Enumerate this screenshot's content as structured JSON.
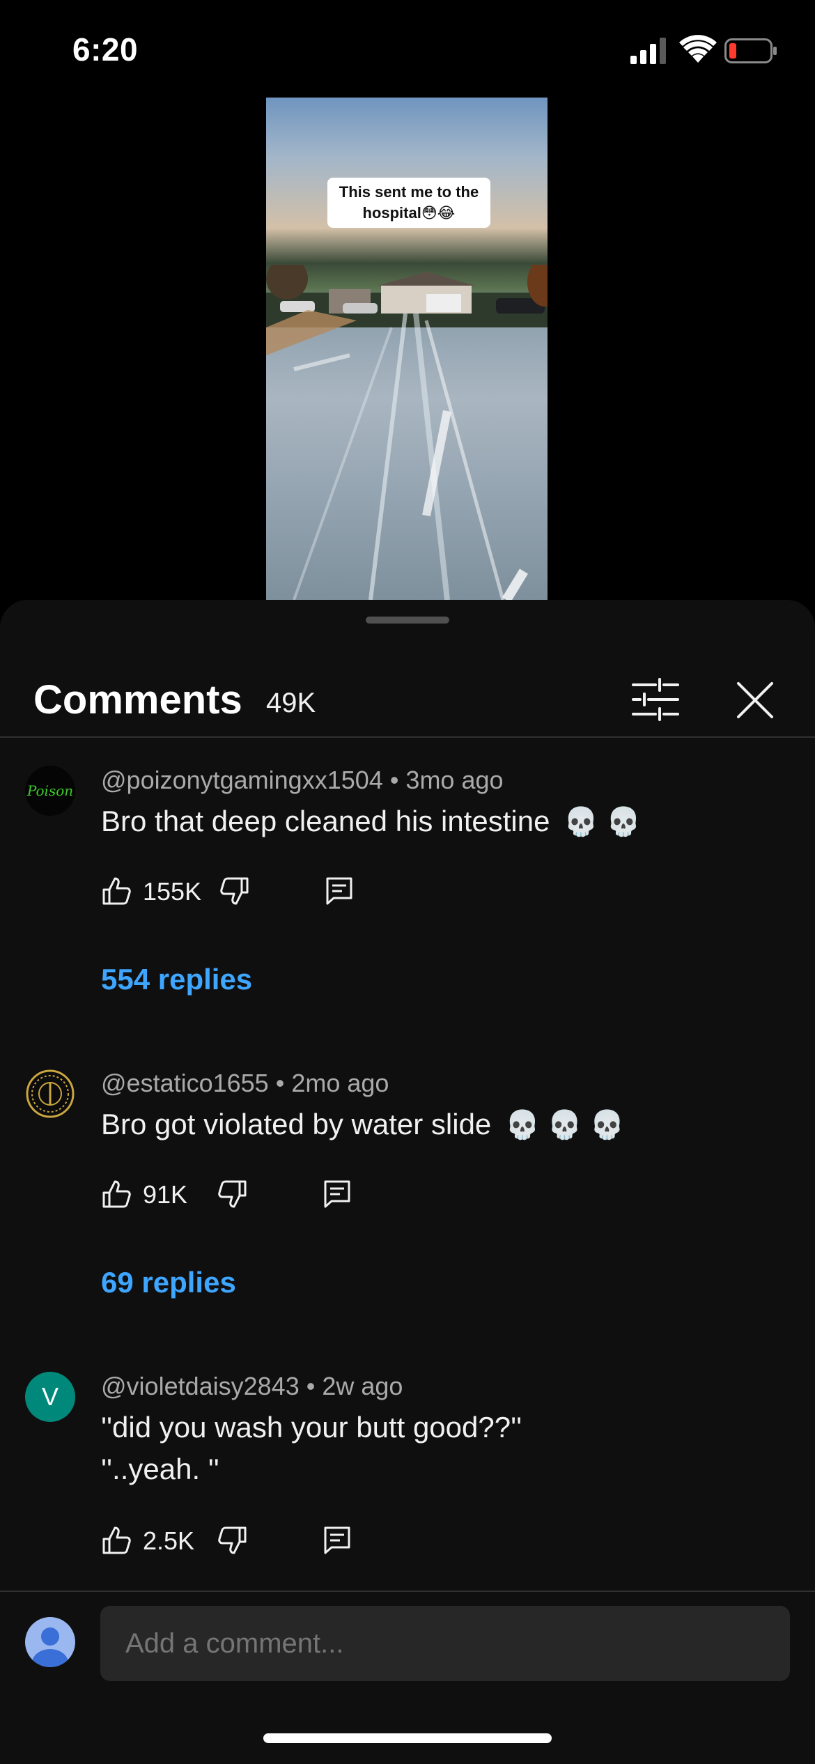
{
  "status_bar": {
    "time": "6:20"
  },
  "video": {
    "overlay_text": "This sent me to the hospital😳😂"
  },
  "comments_sheet": {
    "title": "Comments",
    "count": "49K",
    "input_placeholder": "Add a comment...",
    "comments": [
      {
        "author": "@poizonytgamingxx1504",
        "age": "3mo ago",
        "text": "Bro that deep cleaned his intestine",
        "skulls": "💀 💀",
        "likes": "155K",
        "replies": "554 replies",
        "avatar_label": "Poison"
      },
      {
        "author": "@estatico1655",
        "age": "2mo ago",
        "text": "Bro got violated by water slide",
        "skulls": "💀 💀 💀",
        "likes": "91K",
        "replies": "69 replies"
      },
      {
        "author": "@violetdaisy2843",
        "age": "2w ago",
        "text_line1": "''did you wash your butt good??''",
        "text_line2": "''..yeah. ''",
        "likes": "2.5K",
        "avatar_letter": "V"
      }
    ]
  },
  "colors": {
    "accent_link": "#3ea6ff",
    "sheet_bg": "#0f0f0f",
    "avatar_v": "#00897b"
  }
}
